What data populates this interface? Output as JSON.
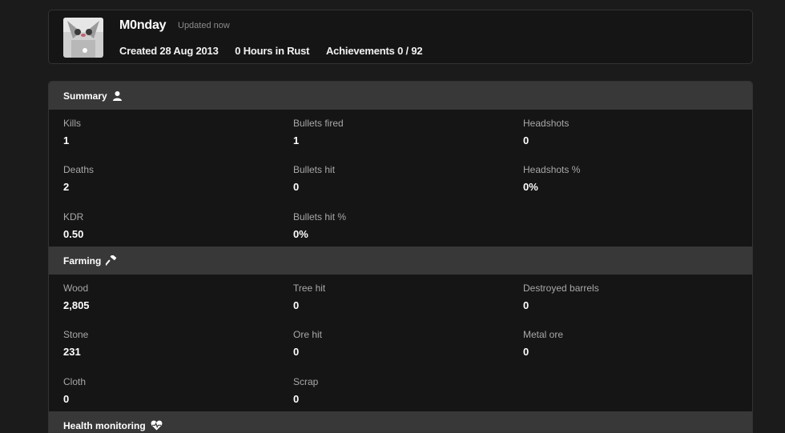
{
  "profile": {
    "name": "M0nday",
    "updated": "Updated now",
    "created": "Created 28 Aug 2013",
    "hours": "0 Hours in Rust",
    "achievements": "Achievements 0 / 92"
  },
  "sections": {
    "summary": {
      "title": "Summary",
      "icon": "user-icon",
      "stats": {
        "kills": {
          "label": "Kills",
          "value": "1"
        },
        "bullets_fired": {
          "label": "Bullets fired",
          "value": "1"
        },
        "headshots": {
          "label": "Headshots",
          "value": "0"
        },
        "deaths": {
          "label": "Deaths",
          "value": "2"
        },
        "bullets_hit": {
          "label": "Bullets hit",
          "value": "0"
        },
        "headshots_pct": {
          "label": "Headshots %",
          "value": "0%"
        },
        "kdr": {
          "label": "KDR",
          "value": "0.50"
        },
        "bullets_hit_pct": {
          "label": "Bullets hit %",
          "value": "0%"
        }
      }
    },
    "farming": {
      "title": "Farming",
      "icon": "hammer-icon",
      "stats": {
        "wood": {
          "label": "Wood",
          "value": "2,805"
        },
        "tree_hit": {
          "label": "Tree hit",
          "value": "0"
        },
        "destroyed_barrels": {
          "label": "Destroyed barrels",
          "value": "0"
        },
        "stone": {
          "label": "Stone",
          "value": "231"
        },
        "ore_hit": {
          "label": "Ore hit",
          "value": "0"
        },
        "metal_ore": {
          "label": "Metal ore",
          "value": "0"
        },
        "cloth": {
          "label": "Cloth",
          "value": "0"
        },
        "scrap": {
          "label": "Scrap",
          "value": "0"
        }
      }
    },
    "health": {
      "title": "Health monitoring",
      "icon": "heart-monitor-icon"
    }
  },
  "colors": {
    "background": "#1b1b1b",
    "card": "#151515",
    "header": "#383838",
    "label": "#a8a8a8"
  }
}
